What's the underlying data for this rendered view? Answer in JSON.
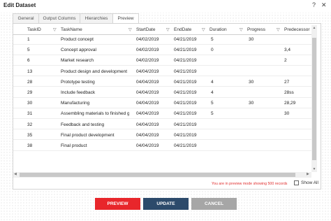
{
  "window": {
    "title": "Edit Dataset",
    "help_glyph": "?",
    "close_glyph": "✕"
  },
  "tabs": [
    {
      "label": "General"
    },
    {
      "label": "Output Columns"
    },
    {
      "label": "Hierarchies"
    },
    {
      "label": "Preview"
    }
  ],
  "active_tab": "Preview",
  "columns": [
    "TaskID",
    "TaskName",
    "StartDate",
    "EndDate",
    "Duration",
    "Progress",
    "Predecessor"
  ],
  "rows": [
    [
      "1",
      "Product concept",
      "04/02/2019",
      "04/21/2019",
      "5",
      "30",
      ""
    ],
    [
      "5",
      "Concept approval",
      "04/02/2019",
      "04/21/2019",
      "0",
      "",
      "3,4"
    ],
    [
      "6",
      "Market research",
      "04/02/2019",
      "04/21/2019",
      "",
      "",
      "2"
    ],
    [
      "13",
      "Product design and development",
      "04/04/2019",
      "04/21/2019",
      "",
      "",
      ""
    ],
    [
      "28",
      "Prototype testing",
      "04/04/2019",
      "04/21/2019",
      "4",
      "30",
      "27"
    ],
    [
      "29",
      "Include feedback",
      "04/04/2019",
      "04/21/2019",
      "4",
      "",
      "28ss"
    ],
    [
      "30",
      "Manufacturing",
      "04/04/2019",
      "04/21/2019",
      "5",
      "30",
      "28,29"
    ],
    [
      "31",
      "Assembling materials to finished go",
      "04/04/2019",
      "04/21/2019",
      "5",
      "",
      "30"
    ],
    [
      "32",
      "Feedback and testing",
      "04/04/2019",
      "04/21/2019",
      "",
      "",
      ""
    ],
    [
      "35",
      "Final product development",
      "04/04/2019",
      "04/21/2019",
      "",
      "",
      ""
    ],
    [
      "38",
      "Final product",
      "04/04/2019",
      "04/21/2019",
      "",
      "",
      ""
    ]
  ],
  "status_text": "You are in preview mode showing 500 records",
  "show_all_label": "Show All",
  "buttons": {
    "preview": "PREVIEW",
    "update": "UPDATE",
    "cancel": "CANCEL"
  },
  "colors": {
    "preview": "#e8262b",
    "update": "#2c4a6b",
    "cancel": "#a6a6a6",
    "status": "#e03030"
  },
  "icons": {
    "filter": "filter-icon"
  }
}
